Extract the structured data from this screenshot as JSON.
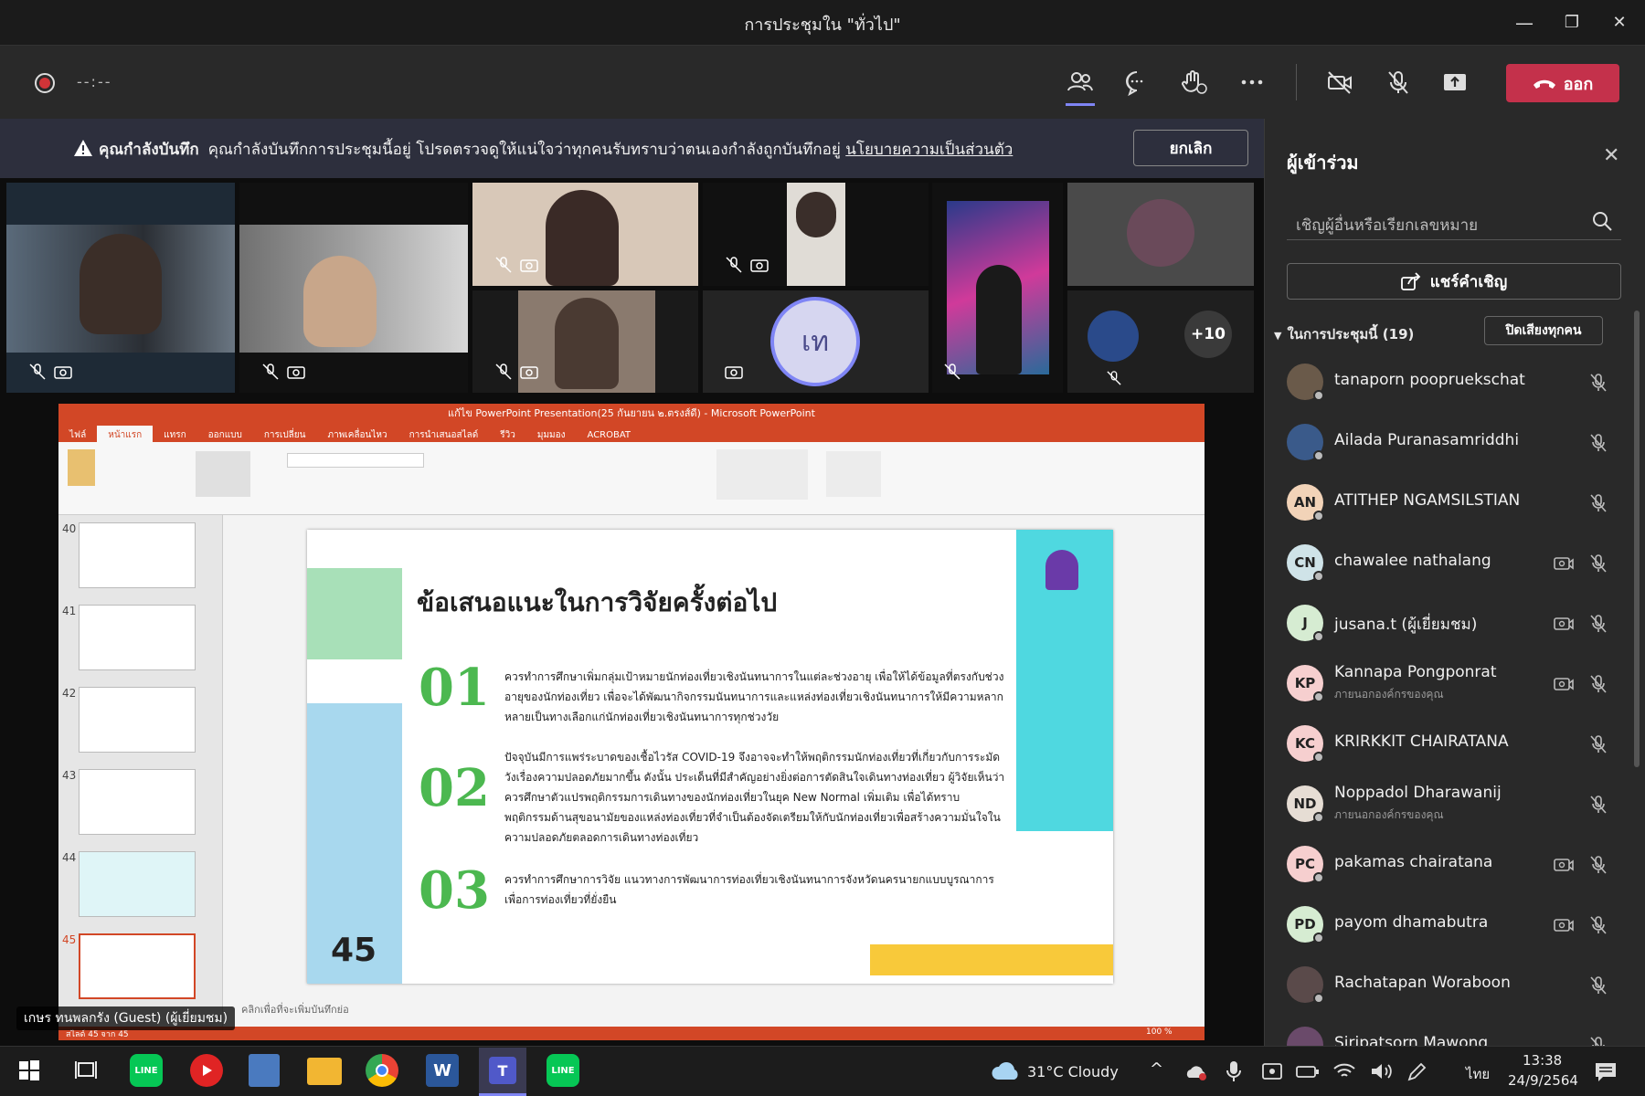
{
  "window": {
    "title": "การประชุมใน \"ทั่วไป\"",
    "minimize": "—",
    "restore": "❐",
    "close": "✕"
  },
  "toolbar": {
    "timer": "--:--",
    "leave_label": "ออก",
    "leave_color": "#c4314b"
  },
  "banner": {
    "heading": "คุณกำลังบันทึก",
    "message": "คุณกำลังบันทึกการประชุมนี้อยู่ โปรดตรวจดูให้แน่ใจว่าทุกคนรับทราบว่าตนเองกำลังถูกบันทึกอยู่",
    "link": "นโยบายความเป็นส่วนตัว",
    "cancel_label": "ยกเลิก"
  },
  "gallery": {
    "initials_tile": "เท",
    "overflow_count": "+10"
  },
  "shared_screen": {
    "window_title": "แก้ไข PowerPoint Presentation(25 กันยายน ๒.ตรงส์ดี) - Microsoft PowerPoint",
    "ribbon_tabs": [
      "ไฟล์",
      "หน้าแรก",
      "แทรก",
      "ออกแบบ",
      "การเปลี่ยน",
      "ภาพเคลื่อนไหว",
      "การนำเสนอสไลด์",
      "รีวิว",
      "มุมมอง",
      "ACROBAT"
    ],
    "thumb_numbers": [
      "40",
      "41",
      "42",
      "43",
      "44",
      "45"
    ],
    "slide": {
      "title": "ข้อเสนอแนะในการวิจัยครั้งต่อไป",
      "number": "45",
      "items": [
        {
          "num": "01",
          "text": "ควรทำการศึกษาเพิ่มกลุ่มเป้าหมายนักท่องเที่ยวเชิงนันทนาการในแต่ละช่วงอายุ เพื่อให้ได้ข้อมูลที่ตรงกับช่วงอายุของนักท่องเที่ยว เพื่อจะได้พัฒนากิจกรรมนันทนาการและแหล่งท่องเที่ยวเชิงนันทนาการให้มีความหลากหลายเป็นทางเลือกแก่นักท่องเที่ยวเชิงนันทนาการทุกช่วงวัย"
        },
        {
          "num": "02",
          "text": "ปัจจุบันมีการแพร่ระบาดของเชื้อไวรัส COVID-19 จึงอาจจะทำให้พฤติกรรมนักท่องเที่ยวที่เกี่ยวกับการระมัดวังเรื่องความปลอดภัยมากขึ้น ดังนั้น ประเด็นที่มีสำคัญอย่างยิ่งต่อการตัดสินใจเดินทางท่องเที่ยว ผู้วิจัยเห็นว่าควรศึกษาตัวแปรพฤติกรรมการเดินทางของนักท่องเที่ยวในยุค New Normal เพิ่มเติม เพื่อได้ทราบพฤติกรรมด้านสุขอนามัยของแหล่งท่องเที่ยวที่จำเป็นต้องจัดเตรียมให้กับนักท่องเที่ยวเพื่อสร้างความมั่นใจในความปลอดภัยตลอดการเดินทางท่องเที่ยว"
        },
        {
          "num": "03",
          "text": "ควรทำการศึกษาการวิจัย แนวทางการพัฒนาการท่องเที่ยวเชิงนันทนาการจังหวัดนครนายกแบบบูรณาการเพื่อการท่องเที่ยวที่ยั่งยืน"
        }
      ]
    },
    "notes_placeholder": "คลิกเพื่อที่จะเพิ่มบันทึกย่อ",
    "status_left": "สไลด์ 45 จาก 45",
    "zoom": "100 %"
  },
  "speaker_label": "เกษร ทนพลกรัง (Guest) (ผู้เยี่ยมชม)",
  "participants_panel": {
    "title": "ผู้เข้าร่วม",
    "invite_placeholder": "เชิญผู้อื่นหรือเรียกเลขหมาย",
    "share_invite_label": "แชร์คำเชิญ",
    "in_meeting_label": "ในการประชุมนี้ (19)",
    "mute_all_label": "ปิดเสียงทุกคน",
    "people": [
      {
        "name": "tanaporn poopruekschat",
        "initials": "",
        "sub": "",
        "cam": false,
        "avatar_color": "#6a5a4a"
      },
      {
        "name": "Ailada Puranasamriddhi",
        "initials": "",
        "sub": "",
        "cam": false,
        "avatar_color": "#3a5a8a"
      },
      {
        "name": "ATITHEP NGAMSILSTIAN",
        "initials": "AN",
        "sub": "",
        "cam": false,
        "avatar_color": "#f2d3b8"
      },
      {
        "name": "chawalee nathalang",
        "initials": "CN",
        "sub": "",
        "cam": true,
        "avatar_color": "#cfe3e8"
      },
      {
        "name": "jusana.t (ผู้เยี่ยมชม)",
        "initials": "J",
        "sub": "",
        "cam": true,
        "avatar_color": "#d6ecd2"
      },
      {
        "name": "Kannapa Pongponrat",
        "initials": "KP",
        "sub": "ภายนอกองค์กรของคุณ",
        "cam": true,
        "avatar_color": "#f6cfcf"
      },
      {
        "name": "KRIRKKIT CHAIRATANA",
        "initials": "KC",
        "sub": "",
        "cam": false,
        "avatar_color": "#f6cfcf"
      },
      {
        "name": "Noppadol Dharawanij",
        "initials": "ND",
        "sub": "ภายนอกองค์กรของคุณ",
        "cam": false,
        "avatar_color": "#e6ddd4"
      },
      {
        "name": "pakamas chairatana",
        "initials": "PC",
        "sub": "",
        "cam": true,
        "avatar_color": "#f6cfcf"
      },
      {
        "name": "payom dhamabutra",
        "initials": "PD",
        "sub": "",
        "cam": true,
        "avatar_color": "#d6ecd2"
      },
      {
        "name": "Rachatapan Woraboon",
        "initials": "",
        "sub": "",
        "cam": false,
        "avatar_color": "#5a4a4a"
      },
      {
        "name": "Siripatsorn Mawong",
        "initials": "",
        "sub": "",
        "cam": false,
        "avatar_color": "#6a4a6a"
      }
    ]
  },
  "taskbar": {
    "weather": "31°C  Cloudy",
    "time": "13:38",
    "date": "24/9/2564",
    "lang": "ไทย"
  }
}
